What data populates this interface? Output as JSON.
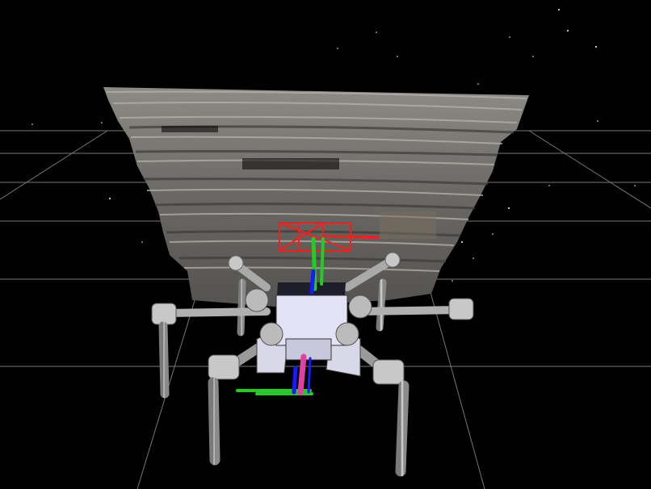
{
  "viewer": {
    "type": "3d-viewport",
    "background_color": "#000000",
    "grid_color": "#8c8c8c",
    "point_cloud_colors": [
      "#9a9a96",
      "#6e6c68",
      "#b3afa8",
      "#55524d"
    ],
    "robot": {
      "name": "hexapod",
      "legs": 6,
      "body_color": "#d8d8ec",
      "joint_color": "#c8c8c8",
      "leg_color": "#bdbdbd"
    },
    "axes_colors": {
      "x": "#ff1a1a",
      "y": "#22cc22",
      "z": "#1a1aff"
    },
    "marker_color": "#ff0000",
    "arrow_color": "#e040a0"
  }
}
